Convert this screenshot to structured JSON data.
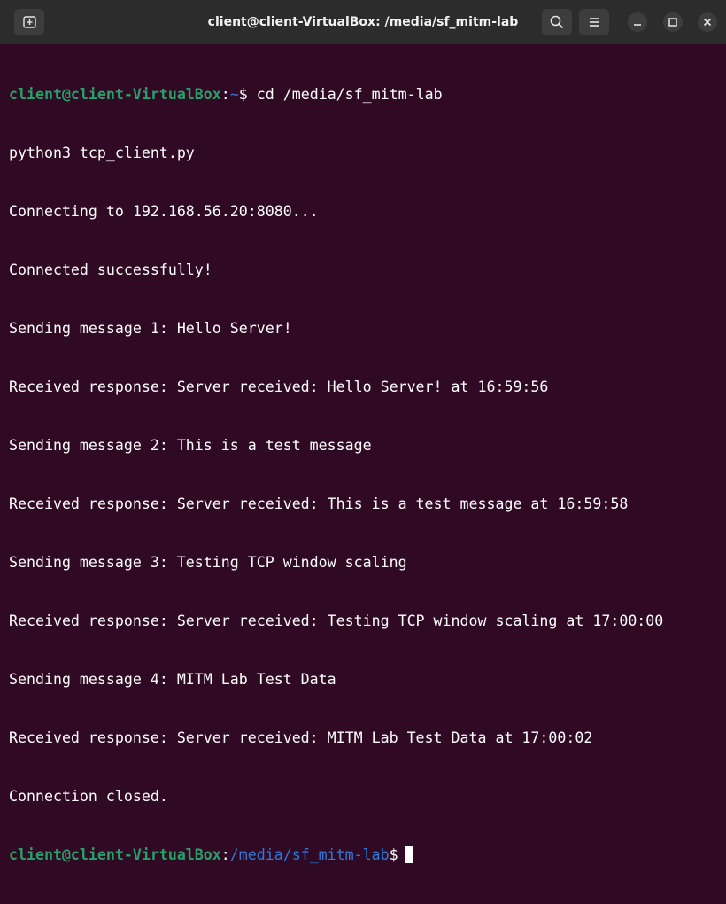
{
  "window": {
    "title": "client@client-VirtualBox: /media/sf_mitm-lab"
  },
  "colors": {
    "background": "#300a24",
    "titlebar": "#2c2c2c",
    "prompt_user": "#26a269",
    "prompt_path": "#2a7bde",
    "text": "#ffffff"
  },
  "icons": {
    "new_tab": "new-tab-icon",
    "search": "search-icon",
    "menu": "hamburger-menu-icon",
    "minimize": "minimize-icon",
    "maximize": "maximize-icon",
    "close": "close-icon"
  },
  "terminal": {
    "prompt1": {
      "user": "client@client-VirtualBox",
      "sep": ":",
      "path": "~",
      "symbol": "$",
      "command": " cd /media/sf_mitm-lab"
    },
    "output": [
      "python3 tcp_client.py",
      "Connecting to 192.168.56.20:8080...",
      "Connected successfully!",
      "Sending message 1: Hello Server!",
      "Received response: Server received: Hello Server! at 16:59:56",
      "Sending message 2: This is a test message",
      "Received response: Server received: This is a test message at 16:59:58",
      "Sending message 3: Testing TCP window scaling",
      "Received response: Server received: Testing TCP window scaling at 17:00:00",
      "Sending message 4: MITM Lab Test Data",
      "Received response: Server received: MITM Lab Test Data at 17:00:02",
      "Connection closed."
    ],
    "prompt2": {
      "user": "client@client-VirtualBox",
      "sep": ":",
      "path": "/media/sf_mitm-lab",
      "symbol": "$"
    }
  }
}
